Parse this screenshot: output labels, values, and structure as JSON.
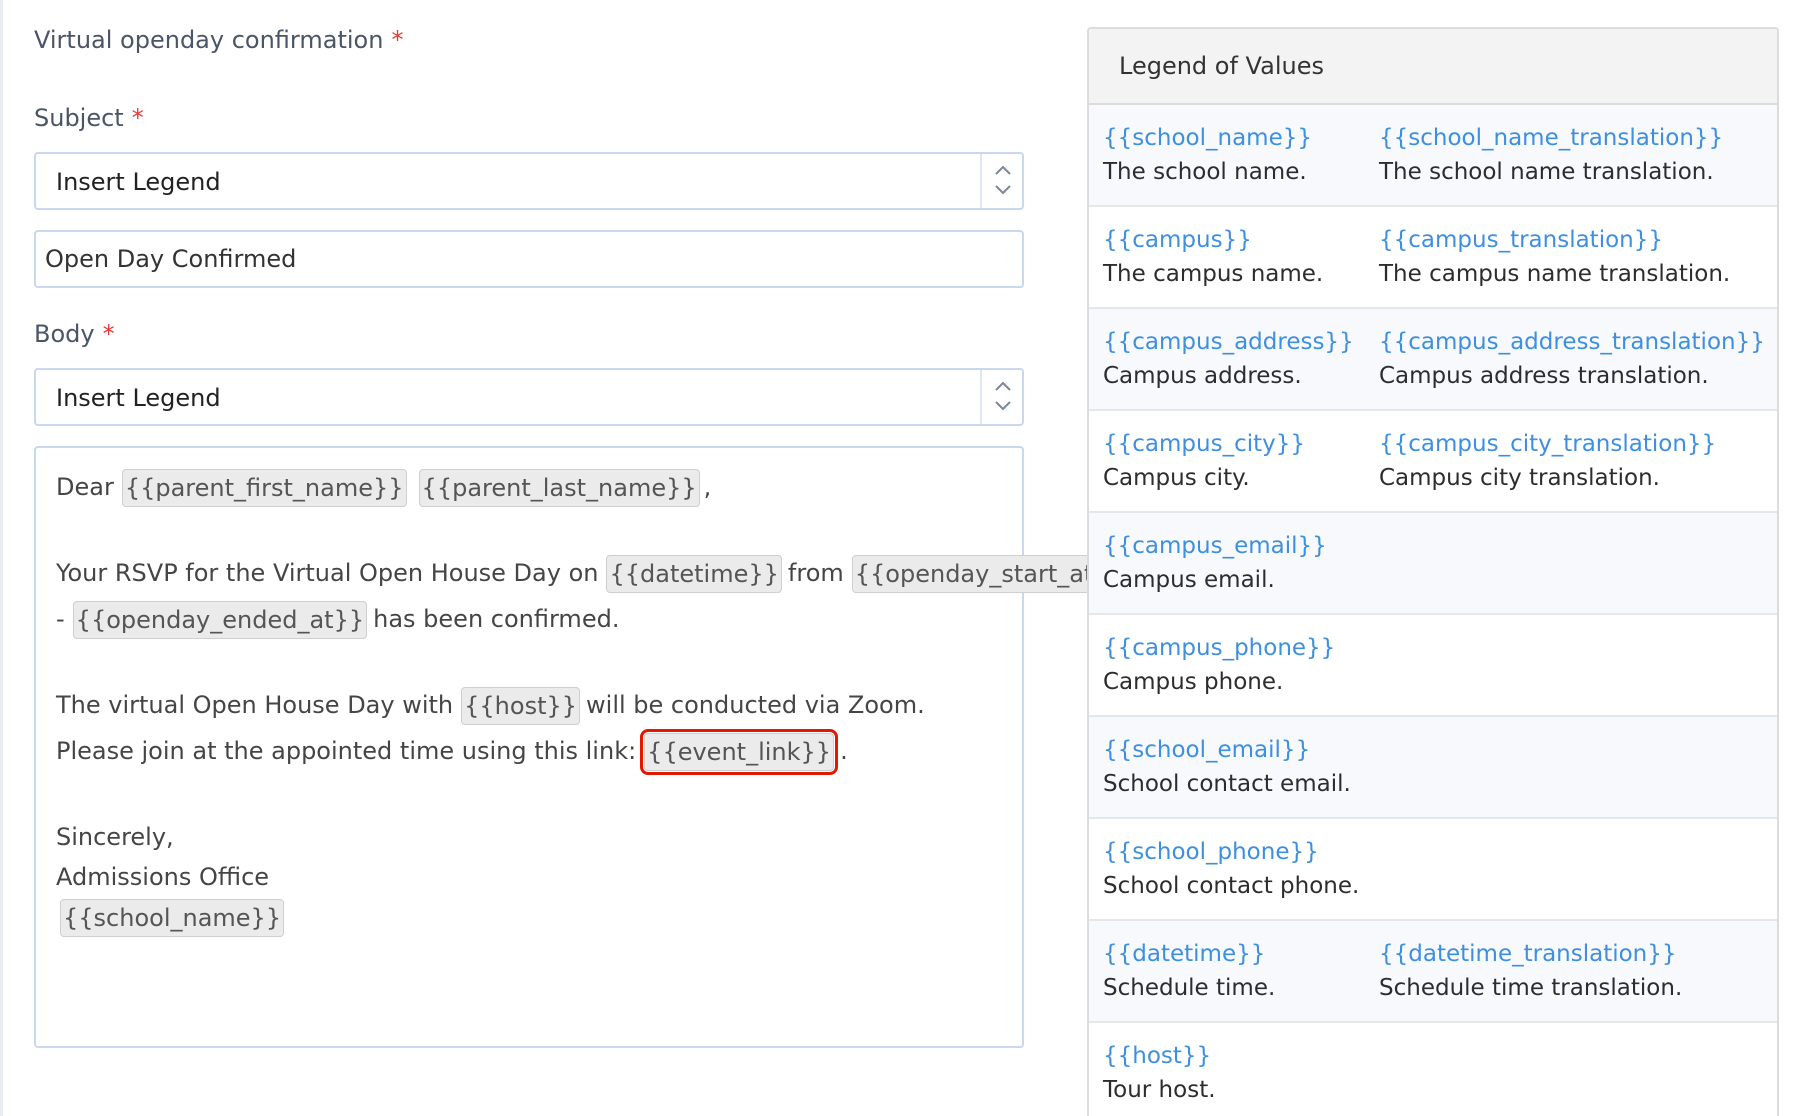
{
  "form": {
    "section_title": "Virtual openday confirmation",
    "required_mark": "*",
    "subject_label": "Subject",
    "subject_select": "Insert Legend",
    "subject_value": "Open Day Confirmed",
    "body_label": "Body",
    "body_select": "Insert Legend"
  },
  "editor": {
    "dear": "Dear",
    "parent_first_name": "{{parent_first_name}}",
    "parent_last_name": "{{parent_last_name}}",
    "comma": ",",
    "rsvp_text": "Your RSVP for the Virtual Open House Day on",
    "datetime": "{{datetime}}",
    "from_text": "from",
    "openday_start_at": "{{openday_start_at}}",
    "dash": "-",
    "openday_ended_at": "{{openday_ended_at}}",
    "confirmed_text": "has been confirmed.",
    "virtual_text": "The virtual Open House Day with",
    "host": "{{host}}",
    "zoom_text": "will be conducted via Zoom.",
    "join_text": "Please join at the appointed time using this link:",
    "event_link": "{{event_link}}",
    "period": ".",
    "sincerely": "Sincerely,",
    "office": "Admissions Office",
    "school_name": "{{school_name}}"
  },
  "legend": {
    "title": "Legend of Values",
    "rows": [
      {
        "k1": "{{school_name}}",
        "d1": "The school name.",
        "k2": "{{school_name_translation}}",
        "d2": "The school name translation."
      },
      {
        "k1": "{{campus}}",
        "d1": "The campus name.",
        "k2": "{{campus_translation}}",
        "d2": "The campus name translation."
      },
      {
        "k1": "{{campus_address}}",
        "d1": "Campus address.",
        "k2": "{{campus_address_translation}}",
        "d2": "Campus address translation."
      },
      {
        "k1": "{{campus_city}}",
        "d1": "Campus city.",
        "k2": "{{campus_city_translation}}",
        "d2": "Campus city translation."
      },
      {
        "k1": "{{campus_email}}",
        "d1": "Campus email."
      },
      {
        "k1": "{{campus_phone}}",
        "d1": "Campus phone."
      },
      {
        "k1": "{{school_email}}",
        "d1": "School contact email."
      },
      {
        "k1": "{{school_phone}}",
        "d1": "School contact phone."
      },
      {
        "k1": "{{datetime}}",
        "d1": "Schedule time.",
        "k2": "{{datetime_translation}}",
        "d2": "Schedule time translation."
      },
      {
        "k1": "{{host}}",
        "d1": "Tour host."
      }
    ]
  },
  "colors": {
    "accent_link": "#3d8fe0",
    "required": "#e53935",
    "highlight_box": "#e11900"
  }
}
